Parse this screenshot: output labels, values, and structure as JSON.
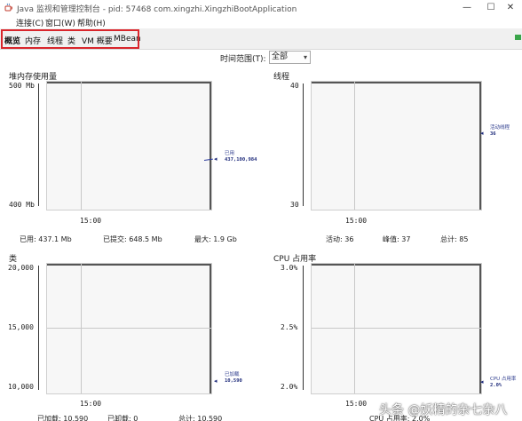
{
  "window": {
    "title": "Java 监视和管理控制台 - pid: 57468 com.xingzhi.XingzhiBootApplication",
    "minimize": "—",
    "maximize": "☐",
    "close": "✕"
  },
  "menu": {
    "items": [
      "连接(C)",
      "窗口(W)",
      "帮助(H)"
    ]
  },
  "tabs": [
    "概览",
    "内存",
    "线程",
    "类",
    "VM 概要",
    "MBean"
  ],
  "time_range": {
    "label": "时间范围(T):",
    "value": "全部"
  },
  "watermark": "头条 @妖精的杂七杂八",
  "panels": {
    "heap": {
      "title": "堆内存使用量",
      "y_top": "500 Mb",
      "y_bottom": "400 Mb",
      "x_tick": "15:00",
      "legend_name": "已用",
      "legend_value": "437,100,984",
      "stats": {
        "used": "已用:   437.1  Mb",
        "committed": "已提交:   648.5  Mb",
        "max": "最大:   1.9  Gb"
      }
    },
    "threads": {
      "title": "线程",
      "y_top": "40",
      "y_bottom": "30",
      "x_tick": "15:00",
      "legend_name": "活动线程",
      "legend_value": "36",
      "stats": {
        "live": "活动:   36",
        "peak": "峰值:   37",
        "total": "总计:   85"
      }
    },
    "classes": {
      "title": "类",
      "y_top": "20,000",
      "y_mid": "15,000",
      "y_bottom": "10,000",
      "x_tick": "15:00",
      "legend_name": "已加载",
      "legend_value": "10,590",
      "stats": {
        "loaded": "已加载:   10,590",
        "unloaded": "已卸载:   0",
        "total": "总计:   10,590"
      }
    },
    "cpu": {
      "title": "CPU 占用率",
      "y_top": "3.0%",
      "y_mid": "2.5%",
      "y_bottom": "2.0%",
      "x_tick": "15:00",
      "legend_name": "CPU 占用率",
      "legend_value": "2.0%",
      "stats": {
        "usage": "CPU 占用率:   2.0%"
      }
    }
  }
}
